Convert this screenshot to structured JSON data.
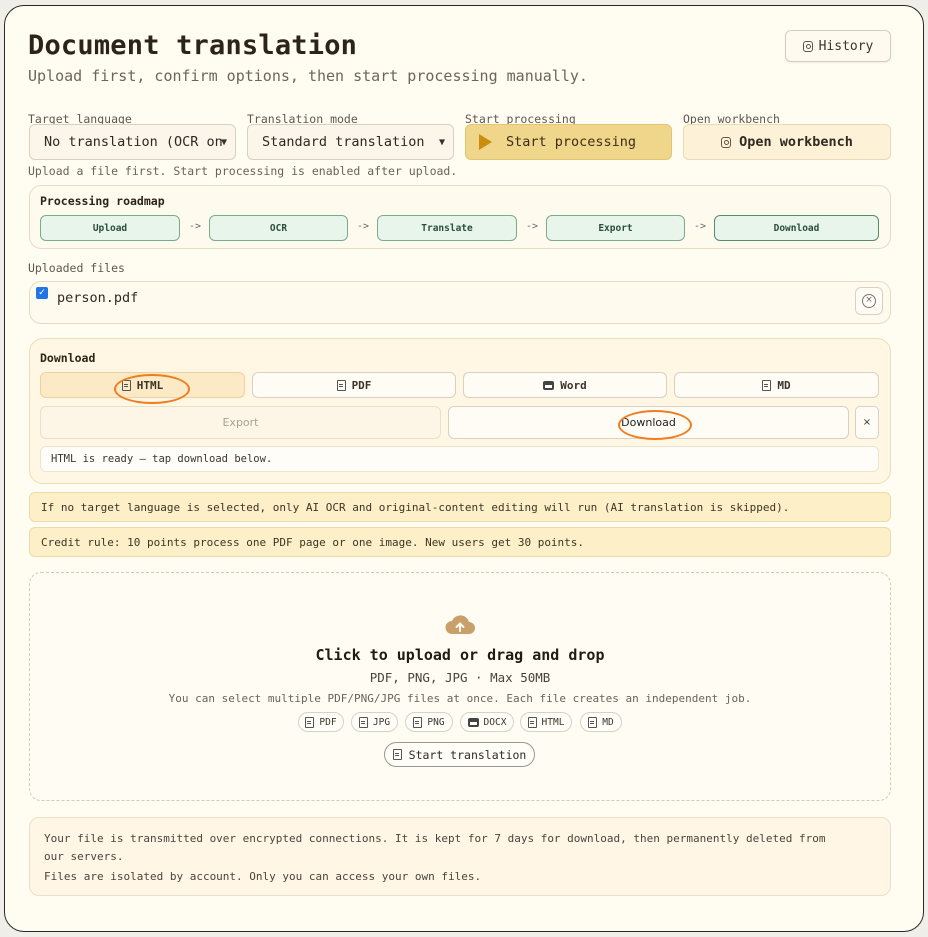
{
  "header": {
    "title": "Document translation",
    "subtitle": "Upload first, confirm options, then start processing manually.",
    "history_label": "History"
  },
  "controls": {
    "target_language_label": "Target language",
    "target_language_value": "No translation (OCR on",
    "translation_mode_label": "Translation mode",
    "translation_mode_value": "Standard translation",
    "start_processing_label": "Start processing",
    "start_processing_button": "Start processing",
    "open_workbench_label": "Open workbench",
    "open_workbench_button": "Open workbench",
    "hint": "Upload a file first. Start processing is enabled after upload."
  },
  "roadmap": {
    "title": "Processing roadmap",
    "steps": [
      "Upload",
      "OCR",
      "Translate",
      "Export",
      "Download"
    ],
    "arrow": "->"
  },
  "uploaded": {
    "label": "Uploaded files",
    "files": [
      {
        "name": "person.pdf",
        "checked": true
      }
    ]
  },
  "download": {
    "title": "Download",
    "formats": [
      "HTML",
      "PDF",
      "Word",
      "MD"
    ],
    "selected_format": "HTML",
    "export_label": "Export",
    "download_label": "Download",
    "close_label": "×",
    "status": "HTML is ready — tap download below."
  },
  "notes": [
    "If no target language is selected, only AI OCR and original-content editing will run (AI translation is skipped).",
    "Credit rule: 10 points process one PDF page or one image. New users get 30 points."
  ],
  "dropzone": {
    "title": "Click to upload or drag and drop",
    "formats_line": "PDF, PNG, JPG · Max 50MB",
    "multi_line": "You can select multiple PDF/PNG/JPG files at once. Each file creates an independent job.",
    "chips": [
      "PDF",
      "JPG",
      "PNG",
      "DOCX",
      "HTML",
      "MD"
    ],
    "start_button": "Start translation"
  },
  "footer": {
    "line1": "Your file is transmitted over encrypted connections. It is kept for 7 days for download, then permanently deleted from our servers.",
    "line2": "Files are isolated by account. Only you can access your own files."
  },
  "colors": {
    "accent_yellow": "#f0d68a",
    "step_green_bg": "#e7f5ea",
    "step_green_border": "#7cab8b",
    "annotation_orange": "#ef7d1f"
  }
}
